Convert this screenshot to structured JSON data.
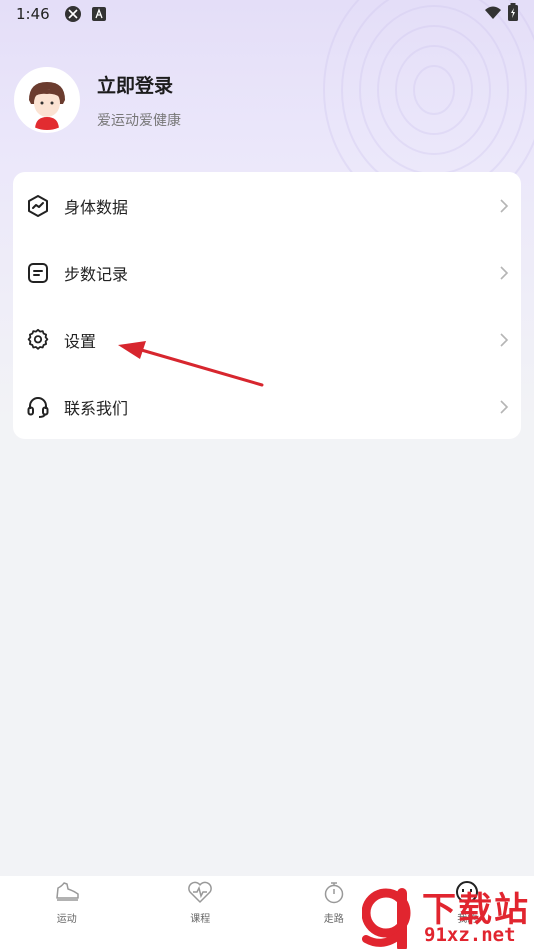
{
  "status_bar": {
    "time": "1:46"
  },
  "profile": {
    "title": "立即登录",
    "subtitle": "爱运动爱健康"
  },
  "menu": {
    "items": [
      {
        "label": "身体数据",
        "icon": "body-data-icon"
      },
      {
        "label": "步数记录",
        "icon": "step-record-icon"
      },
      {
        "label": "设置",
        "icon": "gear-icon"
      },
      {
        "label": "联系我们",
        "icon": "headset-icon"
      }
    ]
  },
  "bottom_nav": {
    "items": [
      {
        "label": "运动",
        "icon": "shoe-icon"
      },
      {
        "label": "课程",
        "icon": "heart-pulse-icon"
      },
      {
        "label": "走路",
        "icon": "stopwatch-icon"
      },
      {
        "label": "我的",
        "icon": "face-icon"
      }
    ]
  },
  "watermark": {
    "top": "下载站",
    "bottom": "91xz.net"
  },
  "colors": {
    "accent_red": "#d7262e",
    "header_lavender": "#e4def8",
    "background": "#f2f3f6"
  }
}
